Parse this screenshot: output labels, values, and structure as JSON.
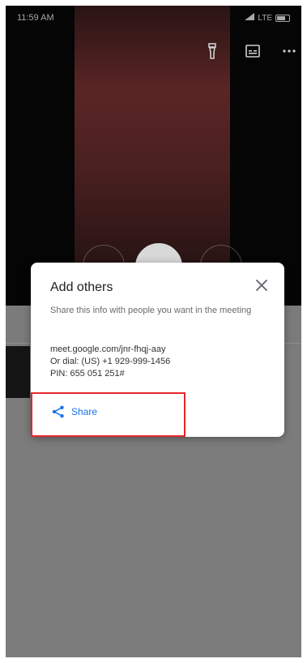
{
  "status_bar": {
    "time": "11:59 AM",
    "network": "LTE"
  },
  "dialog": {
    "title": "Add others",
    "description": "Share this info with people you want in the meeting",
    "meeting_link": "meet.google.com/jnr-fhqj-aay",
    "dial_in": "Or dial: (US) +1 929-999-1456",
    "pin": "PIN: 655 051 251#",
    "share_label": "Share",
    "close_icon": "close-icon",
    "share_icon": "share-icon"
  },
  "toolbar": {
    "icons": [
      "flash-icon",
      "captions-icon",
      "more-options-icon"
    ]
  },
  "colors": {
    "accent": "#1a73e8",
    "highlight": "#e5262c",
    "scrim": "#7c7c7c"
  }
}
